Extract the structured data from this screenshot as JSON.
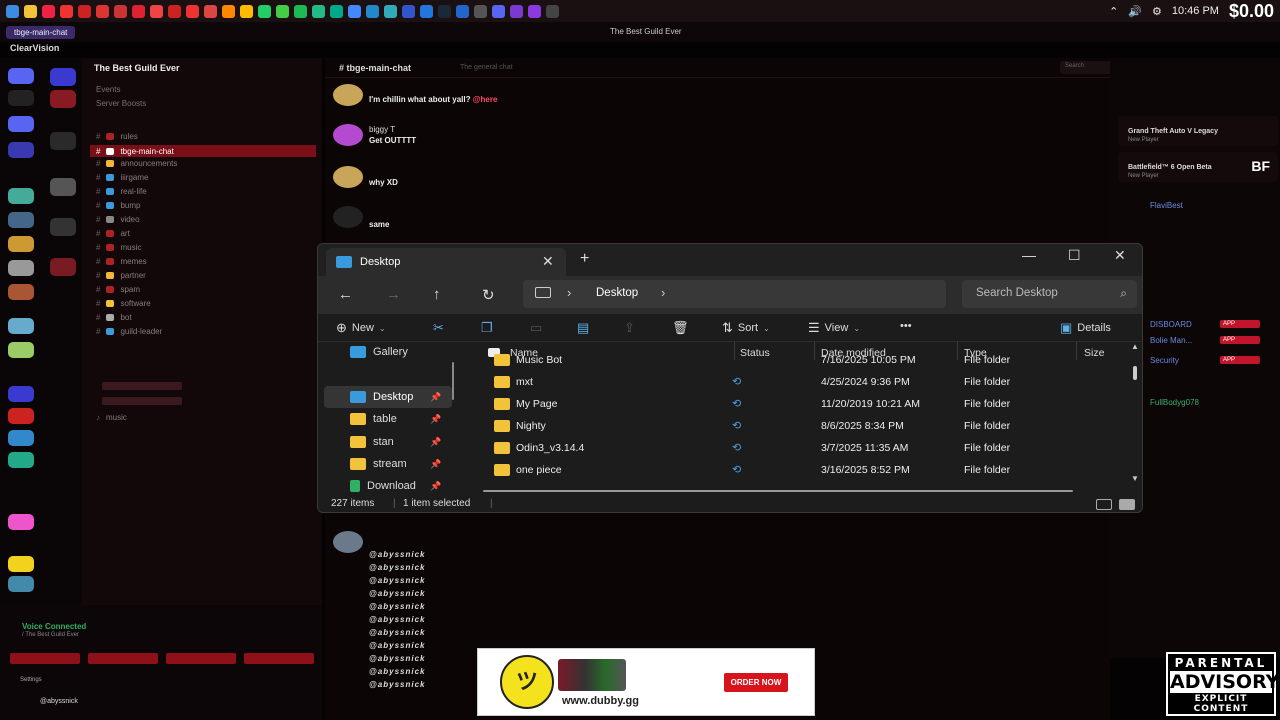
{
  "taskbar": {
    "time": "10:46 PM",
    "money": "$0.00"
  },
  "discord": {
    "brand": "ClearVision",
    "tab": "tbge-main-chat",
    "window_title": "The Best Guild Ever",
    "guild_name": "The Best Guild Ever",
    "sidebar_items": [
      "Events",
      "Server Boosts"
    ],
    "channels": [
      "rules",
      "tbge-main-chat",
      "announcements",
      "iiirgame",
      "real-life",
      "bump",
      "video",
      "art",
      "music",
      "memes",
      "partner",
      "spam",
      "software",
      "bot",
      "guild-leader"
    ],
    "voice_channel": "music",
    "voice_status": "Voice Connected",
    "voice_sub": "/ The Best Guild Ever",
    "settings_label": "Settings",
    "chat_channel": "tbge-main-chat",
    "chat_topic": "The general chat",
    "search_placeholder": "Search",
    "messages": [
      {
        "author": "",
        "text": "I'm chillin what about yall?",
        "ping": "@here"
      },
      {
        "author": "biggy T",
        "text": "Get OUTTTT",
        "ping": ""
      },
      {
        "author": "",
        "text": "why XD",
        "ping": ""
      },
      {
        "author": "",
        "text": "same",
        "ping": ""
      }
    ],
    "repeat_line": "@abyssnick",
    "activities": [
      {
        "title": "Grand Theft Auto V Legacy",
        "sub": "New Player"
      },
      {
        "title": "Battlefield™ 6 Open Beta",
        "sub": "New Player",
        "badge": "BF"
      }
    ],
    "members": [
      "FlaviBest",
      "Bolie Man...",
      "DISBOARD",
      "Security",
      "FullBodyg078"
    ]
  },
  "explorer": {
    "tab_title": "Desktop",
    "address": "Desktop",
    "search_placeholder": "Search Desktop",
    "toolbar": {
      "new": "New",
      "sort": "Sort",
      "view": "View",
      "details": "Details",
      "more": "•••"
    },
    "columns": {
      "name": "Name",
      "status": "Status",
      "date": "Date modified",
      "type": "Type",
      "size": "Size"
    },
    "nav": [
      {
        "label": "Gallery",
        "pinned": false
      },
      {
        "label": "Desktop",
        "pinned": true
      },
      {
        "label": "table",
        "pinned": true
      },
      {
        "label": "stan",
        "pinned": true
      },
      {
        "label": "stream",
        "pinned": true
      },
      {
        "label": "Download",
        "pinned": true
      }
    ],
    "files": [
      {
        "name": "Music Bot",
        "date": "7/16/2025 10:05 PM",
        "type": "File folder"
      },
      {
        "name": "mxt",
        "date": "4/25/2024 9:36 PM",
        "type": "File folder"
      },
      {
        "name": "My Page",
        "date": "11/20/2019 10:21 AM",
        "type": "File folder"
      },
      {
        "name": "Nighty",
        "date": "8/6/2025 8:34 PM",
        "type": "File folder"
      },
      {
        "name": "Odin3_v3.14.4",
        "date": "3/7/2025 11:35 AM",
        "type": "File folder"
      },
      {
        "name": "one piece",
        "date": "3/16/2025 8:52 PM",
        "type": "File folder"
      }
    ],
    "status_items": "227 items",
    "status_selected": "1 item selected"
  },
  "ad": {
    "url": "www.dubby.gg",
    "cta": "ORDER NOW"
  },
  "advisory": {
    "line1": "PARENTAL",
    "line2": "ADVISORY",
    "line3": "EXPLICIT CONTENT"
  }
}
